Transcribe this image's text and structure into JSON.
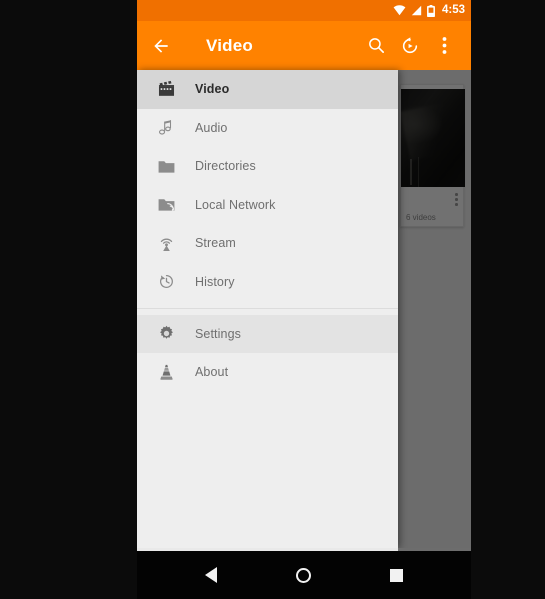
{
  "status_bar": {
    "time": "4:53",
    "icons": [
      "wifi-icon",
      "signal-icon",
      "battery-icon"
    ]
  },
  "toolbar": {
    "back_icon": "back-arrow-icon",
    "title": "Video",
    "actions": [
      {
        "name": "search-icon",
        "label": "Search"
      },
      {
        "name": "history-play-icon",
        "label": "Resume playback"
      },
      {
        "name": "overflow-menu-icon",
        "label": "More options"
      }
    ]
  },
  "drawer": {
    "items": [
      {
        "label": "Video",
        "icon": "movie-icon",
        "selected": true,
        "pressed": false
      },
      {
        "label": "Audio",
        "icon": "music-note-icon",
        "selected": false,
        "pressed": false
      },
      {
        "label": "Directories",
        "icon": "folder-icon",
        "selected": false,
        "pressed": false
      },
      {
        "label": "Local Network",
        "icon": "folder-network-icon",
        "selected": false,
        "pressed": false
      },
      {
        "label": "Stream",
        "icon": "broadcast-icon",
        "selected": false,
        "pressed": false
      },
      {
        "label": "History",
        "icon": "history-clock-icon",
        "selected": false,
        "pressed": false
      }
    ],
    "secondary_items": [
      {
        "label": "Settings",
        "icon": "gear-icon",
        "selected": false,
        "pressed": true
      },
      {
        "label": "About",
        "icon": "vlc-cone-icon",
        "selected": false,
        "pressed": false
      }
    ]
  },
  "content": {
    "video_card": {
      "subtitle": "6 videos",
      "overflow_icon": "kebab-menu-icon",
      "thumbnail": "video-thumbnail"
    }
  },
  "nav_bar": {
    "buttons": [
      {
        "name": "nav-back-button",
        "label": "Back"
      },
      {
        "name": "nav-home-button",
        "label": "Home"
      },
      {
        "name": "nav-recents-button",
        "label": "Recents"
      }
    ]
  },
  "colors": {
    "accent_orange": "#ff8200",
    "status_orange": "#f07000",
    "drawer_bg": "#eeeeee",
    "selected_row": "#d6d6d6",
    "nav_bar": "#030303"
  }
}
